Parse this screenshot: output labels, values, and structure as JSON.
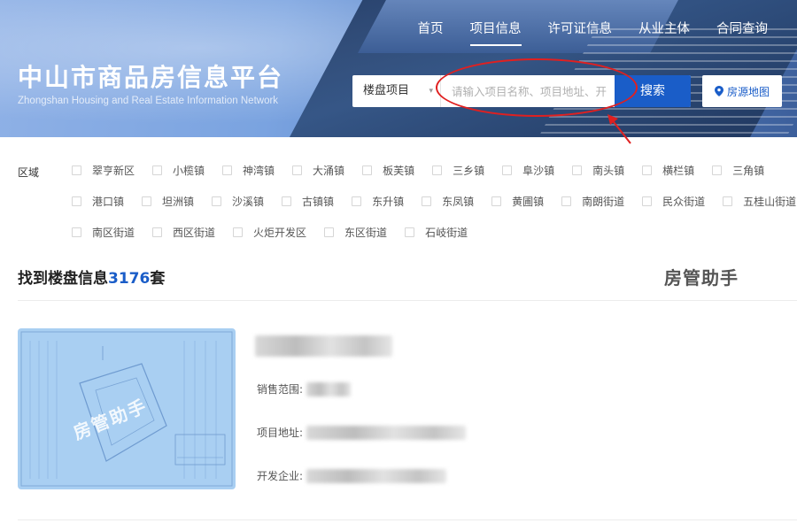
{
  "header": {
    "title": "中山市商品房信息平台",
    "subtitle": "Zhongshan Housing and Real Estate Information Network",
    "nav": [
      {
        "label": "首页",
        "active": false
      },
      {
        "label": "项目信息",
        "active": true
      },
      {
        "label": "许可证信息",
        "active": false
      },
      {
        "label": "从业主体",
        "active": false
      },
      {
        "label": "合同查询",
        "active": false
      }
    ],
    "search": {
      "select_value": "楼盘项目",
      "placeholder": "请输入项目名称、项目地址、开",
      "button_label": "搜索"
    },
    "map_button_label": "房源地图",
    "accent_color": "#1a5dc8",
    "annotation_color": "#e02020"
  },
  "filters": {
    "region_label": "区域",
    "regions": [
      [
        "翠亨新区",
        "小榄镇",
        "神湾镇",
        "大涌镇",
        "板芙镇",
        "三乡镇",
        "阜沙镇",
        "南头镇",
        "横栏镇",
        "三角镇"
      ],
      [
        "港口镇",
        "坦洲镇",
        "沙溪镇",
        "古镇镇",
        "东升镇",
        "东凤镇",
        "黄圃镇",
        "南朗街道",
        "民众街道",
        "五桂山街道"
      ],
      [
        "南区街道",
        "西区街道",
        "火炬开发区",
        "东区街道",
        "石岐街道"
      ]
    ]
  },
  "results": {
    "prefix": "找到楼盘信息",
    "count": "3176",
    "suffix": "套",
    "helper_label": "房管助手",
    "card": {
      "watermark": "房管助手",
      "sales_range_label": "销售范围:",
      "address_label": "项目地址:",
      "developer_label": "开发企业:"
    }
  }
}
